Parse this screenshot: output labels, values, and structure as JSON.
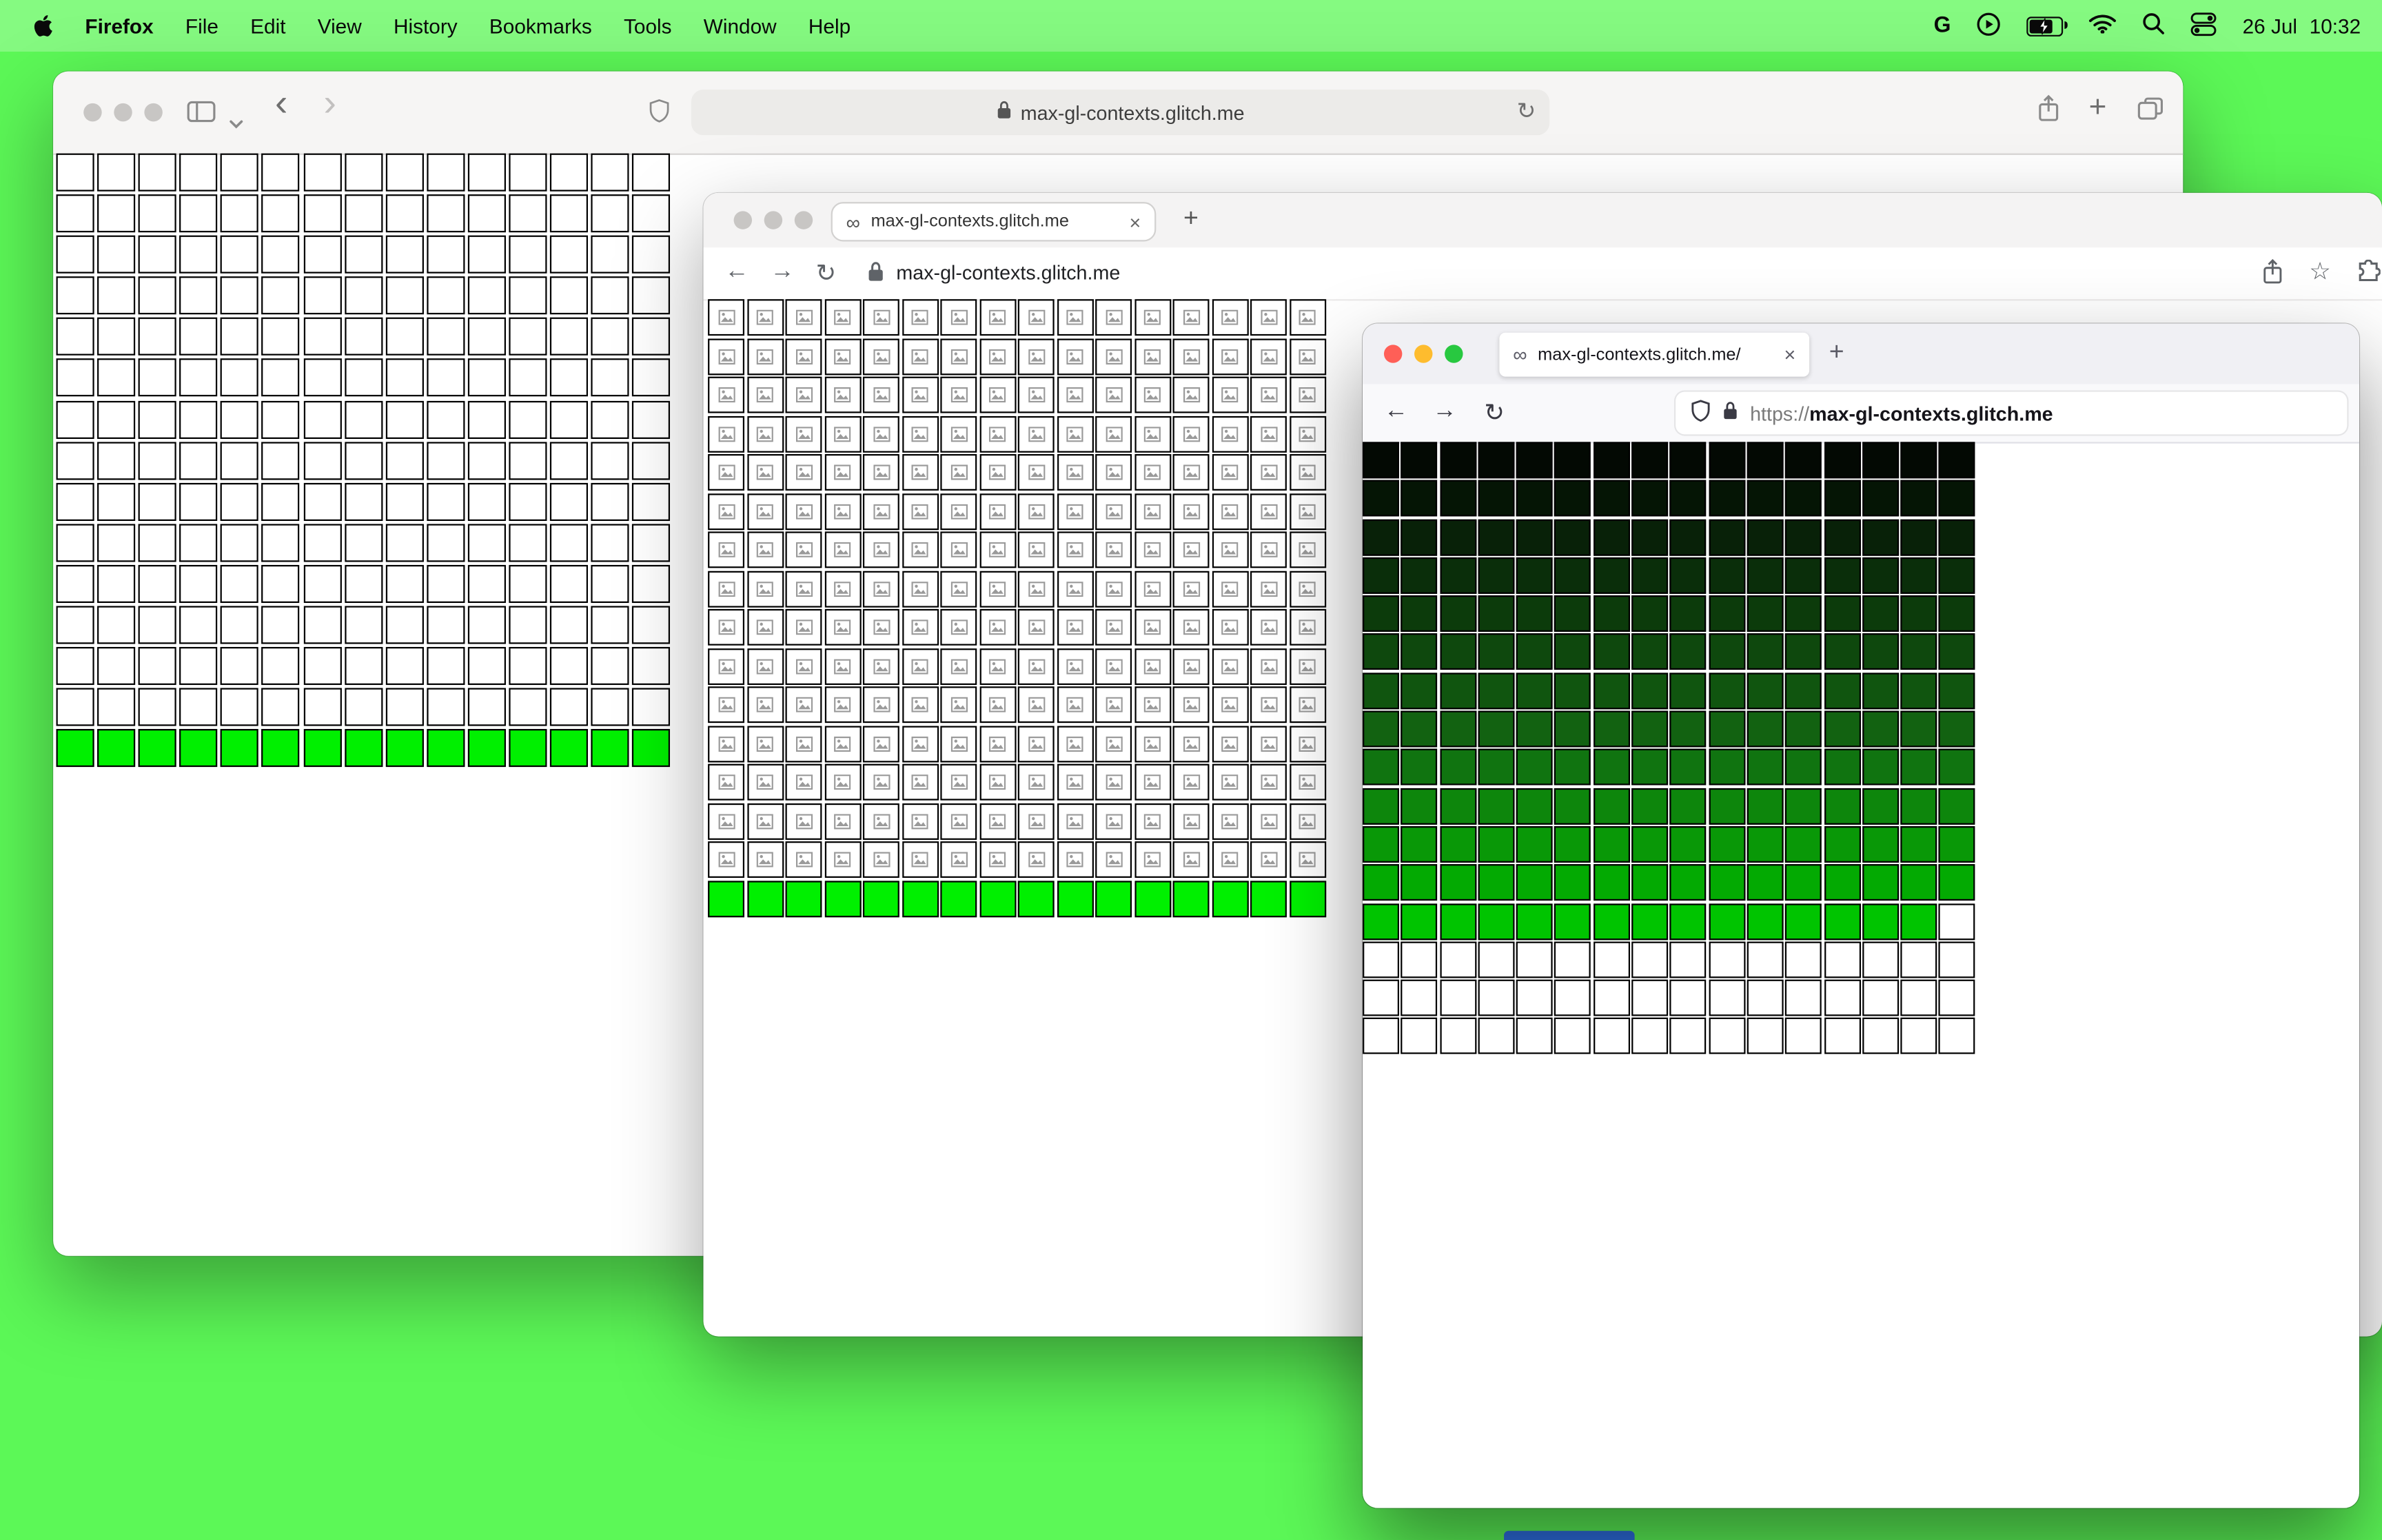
{
  "colors": {
    "desktop_bg": "#5cf857",
    "dock_hint": "#2e6fe2",
    "traffic_inactive": "#c8c6c4",
    "traffic_red": "#ff5f57",
    "traffic_yellow": "#febc2e",
    "traffic_green": "#28c840"
  },
  "icons": {
    "plus": "+",
    "close": "×",
    "infinity": "∞",
    "reload": "↻",
    "back_arrow": "←",
    "forward_arrow": "→",
    "back_angle": "‹",
    "forward_angle": "›",
    "star": "☆",
    "g": "G"
  },
  "menubar": {
    "app_name": "Firefox",
    "menus": [
      "File",
      "Edit",
      "View",
      "History",
      "Bookmarks",
      "Tools",
      "Window",
      "Help"
    ],
    "clock": {
      "date": "26 Jul",
      "time": "10:32"
    }
  },
  "safari": {
    "urlbar": "max-gl-contexts.glitch.me",
    "grid": {
      "cols": 15,
      "cell": 25,
      "gap": 2.1,
      "rows": [
        {
          "c": "#ffffff",
          "n": 15
        },
        {
          "c": "#ffffff",
          "n": 15
        },
        {
          "c": "#ffffff",
          "n": 15
        },
        {
          "c": "#ffffff",
          "n": 15
        },
        {
          "c": "#ffffff",
          "n": 15
        },
        {
          "c": "#ffffff",
          "n": 15
        },
        {
          "c": "#ffffff",
          "n": 15
        },
        {
          "c": "#ffffff",
          "n": 15
        },
        {
          "c": "#ffffff",
          "n": 15
        },
        {
          "c": "#ffffff",
          "n": 15
        },
        {
          "c": "#ffffff",
          "n": 15
        },
        {
          "c": "#ffffff",
          "n": 15
        },
        {
          "c": "#ffffff",
          "n": 15
        },
        {
          "c": "#ffffff",
          "n": 15
        },
        {
          "c": "#00f000",
          "n": 15
        }
      ]
    }
  },
  "chrome": {
    "tab_title": "max-gl-contexts.glitch.me",
    "urlbar": "max-gl-contexts.glitch.me",
    "grid": {
      "cols": 16,
      "cell": 24,
      "gap": 1.5,
      "rows": [
        {
          "c": "#ffffff",
          "n": 16,
          "icon": true
        },
        {
          "c": "#ffffff",
          "n": 16,
          "icon": true
        },
        {
          "c": "#ffffff",
          "n": 16,
          "icon": true
        },
        {
          "c": "#ffffff",
          "n": 16,
          "icon": true
        },
        {
          "c": "#ffffff",
          "n": 16,
          "icon": true
        },
        {
          "c": "#ffffff",
          "n": 16,
          "icon": true
        },
        {
          "c": "#ffffff",
          "n": 16,
          "icon": true
        },
        {
          "c": "#ffffff",
          "n": 16,
          "icon": true
        },
        {
          "c": "#ffffff",
          "n": 16,
          "icon": true
        },
        {
          "c": "#ffffff",
          "n": 16,
          "icon": true
        },
        {
          "c": "#ffffff",
          "n": 16,
          "icon": true
        },
        {
          "c": "#ffffff",
          "n": 16,
          "icon": true
        },
        {
          "c": "#ffffff",
          "n": 16,
          "icon": true
        },
        {
          "c": "#ffffff",
          "n": 16,
          "icon": true
        },
        {
          "c": "#ffffff",
          "n": 16,
          "icon": true
        },
        {
          "c": "#00f000",
          "n": 16
        }
      ]
    }
  },
  "firefox": {
    "tab_title": "max-gl-contexts.glitch.me/",
    "url_scheme": "https://",
    "url_host": "max-gl-contexts.glitch.me",
    "grid": {
      "cols": 16,
      "cell": 24,
      "gap": 1.3,
      "rows": [
        {
          "c": "#030903",
          "n": 16
        },
        {
          "c": "#051505",
          "n": 16
        },
        {
          "c": "#082108",
          "n": 16
        },
        {
          "c": "#0a2e0a",
          "n": 16
        },
        {
          "c": "#0c3b0b",
          "n": 16
        },
        {
          "c": "#0e480d",
          "n": 16
        },
        {
          "c": "#10550f",
          "n": 16
        },
        {
          "c": "#126211",
          "n": 16
        },
        {
          "c": "#107410",
          "n": 16
        },
        {
          "c": "#0d860c",
          "n": 16
        },
        {
          "c": "#099807",
          "n": 16
        },
        {
          "c": "#03aa02",
          "n": 16
        },
        {
          "c": "#00c400",
          "n": 15
        },
        {
          "c": "#ffffff",
          "n": 16
        },
        {
          "c": "#ffffff",
          "n": 16
        },
        {
          "c": "#ffffff",
          "n": 16
        }
      ]
    }
  }
}
